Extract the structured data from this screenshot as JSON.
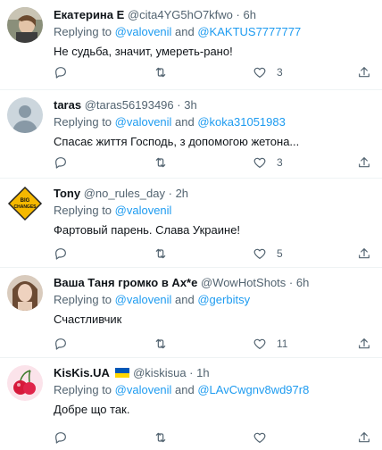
{
  "tweets": [
    {
      "name": "Екатерина Е",
      "handle": "@cita4YG5hO7kfwo",
      "time": "6h",
      "replying_prefix": "Replying to ",
      "mention1": "@valovenil",
      "and": " and ",
      "mention2": "@KAKTUS7777777",
      "text": "Не судьба, значит, умереть-рано!",
      "likes": "3",
      "retweets": ""
    },
    {
      "name": "taras",
      "handle": "@taras56193496",
      "time": "3h",
      "replying_prefix": "Replying to ",
      "mention1": "@valovenil",
      "and": " and ",
      "mention2": "@koka31051983",
      "text": "Спасає життя Господь, з допомогою жетона...",
      "likes": "3",
      "retweets": ""
    },
    {
      "name": "Tony",
      "handle": "@no_rules_day",
      "time": "2h",
      "replying_prefix": "Replying to ",
      "mention1": "@valovenil",
      "and": "",
      "mention2": "",
      "text": "Фартовый парень. Слава Украине!",
      "likes": "5",
      "retweets": ""
    },
    {
      "name": "Ваша Таня громко в Ах*е",
      "handle": "@WowHotShots",
      "time": "6h",
      "replying_prefix": "Replying to ",
      "mention1": "@valovenil",
      "and": " and ",
      "mention2": "@gerbitsy",
      "text": "Счастливчик",
      "likes": "11",
      "retweets": ""
    },
    {
      "name": "KisKis.UA",
      "handle": "@kiskisua",
      "time": "1h",
      "replying_prefix": "Replying to ",
      "mention1": "@valovenil",
      "and": " and ",
      "mention2": "@LAvCwgnv8wd97r8",
      "text": "Добре що так.",
      "likes": "",
      "retweets": ""
    }
  ],
  "separator": "·",
  "avatar_5_text": "BIG CHANGES",
  "colors": {
    "link": "#1d9bf0",
    "muted": "#536471",
    "flag_blue": "#0057b7",
    "flag_yellow": "#ffd700"
  },
  "icons": [
    "reply-icon",
    "retweet-icon",
    "like-icon",
    "share-icon"
  ]
}
